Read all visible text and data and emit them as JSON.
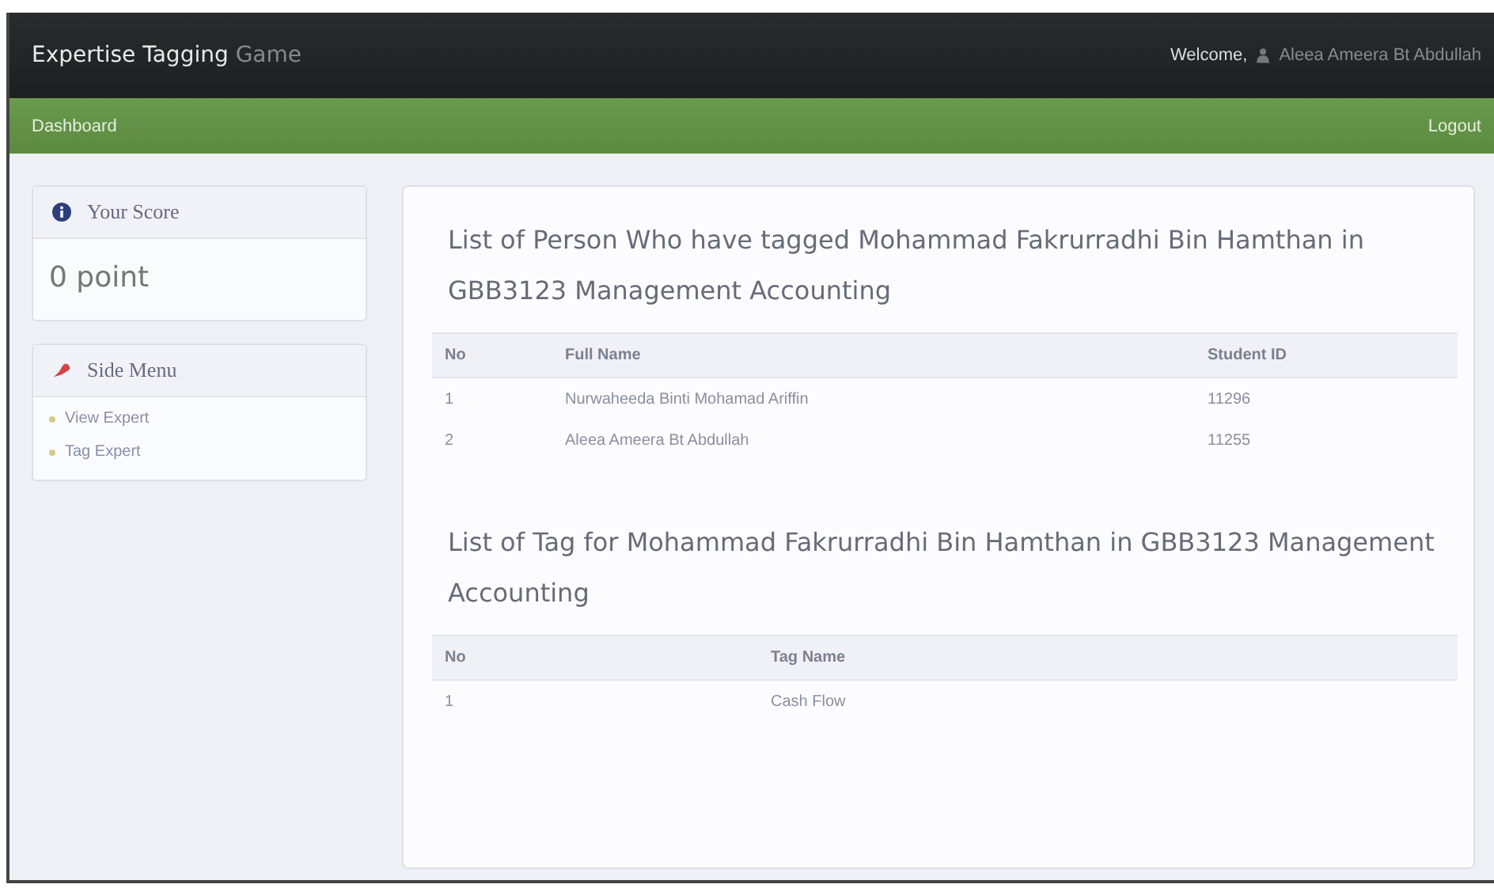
{
  "navbar": {
    "brand": "Expertise Tagging",
    "brand_suffix": "Game",
    "welcome": "Welcome,",
    "user": "Aleea Ameera Bt Abdullah"
  },
  "subnav": {
    "items": [
      {
        "label": "Dashboard"
      }
    ],
    "logout": "Logout"
  },
  "score_panel": {
    "title": "Your Score",
    "value": "0 point"
  },
  "side_menu": {
    "title": "Side Menu",
    "items": [
      {
        "label": "View Expert"
      },
      {
        "label": "Tag Expert"
      }
    ]
  },
  "taggers": {
    "heading": "List of Person Who have tagged Mohammad Fakrurradhi Bin Hamthan in GBB3123 Management Accounting",
    "columns": [
      "No",
      "Full Name",
      "Student ID"
    ],
    "rows": [
      [
        "1",
        "Nurwaheeda Binti Mohamad Ariffin",
        "11296"
      ],
      [
        "2",
        "Aleea Ameera Bt Abdullah",
        "11255"
      ]
    ]
  },
  "tags": {
    "heading": "List of Tag for Mohammad Fakrurradhi Bin Hamthan in GBB3123 Management Accounting",
    "columns": [
      "No",
      "Tag Name"
    ],
    "rows": [
      [
        "1",
        "Cash Flow"
      ]
    ]
  }
}
